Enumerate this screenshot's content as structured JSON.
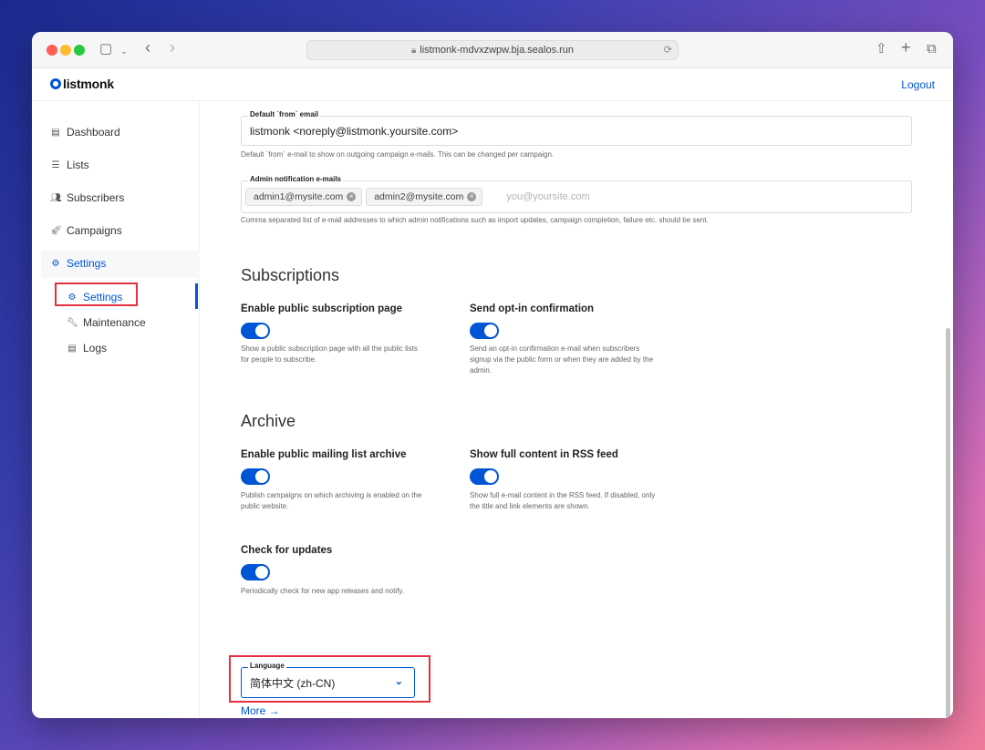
{
  "browser": {
    "url": "listmonk-mdvxzwpw.bja.sealos.run",
    "translate_icon": "translate-icon",
    "reload_icon": "reload-icon"
  },
  "app": {
    "logo": "listmonk",
    "logout": "Logout"
  },
  "sidebar": {
    "items": [
      {
        "label": "Dashboard",
        "icon": "dashboard-icon"
      },
      {
        "label": "Lists",
        "icon": "list-icon"
      },
      {
        "label": "Subscribers",
        "icon": "users-icon"
      },
      {
        "label": "Campaigns",
        "icon": "rocket-icon"
      },
      {
        "label": "Settings",
        "icon": "gear-icon"
      }
    ],
    "subitems": [
      {
        "label": "Settings",
        "icon": "gear-icon"
      },
      {
        "label": "Maintenance",
        "icon": "wrench-icon"
      },
      {
        "label": "Logs",
        "icon": "log-icon"
      }
    ]
  },
  "general": {
    "from_email": {
      "label": "Default `from` email",
      "value": "listmonk <noreply@listmonk.yoursite.com>",
      "help": "Default `from` e-mail to show on outgoing campaign e-mails. This can be changed per campaign."
    },
    "admin_emails": {
      "label": "Admin notification e-mails",
      "tags": [
        "admin1@mysite.com",
        "admin2@mysite.com"
      ],
      "placeholder": "you@yoursite.com",
      "help": "Comma separated list of e-mail addresses to which admin notifications such as import updates, campaign completion, failure etc. should be sent."
    }
  },
  "subscriptions": {
    "title": "Subscriptions",
    "public_page": {
      "title": "Enable public subscription page",
      "enabled": true,
      "help1": "Show a public subscription page with all the public lists",
      "help2": "for people to subscribe."
    },
    "optin": {
      "title": "Send opt-in confirmation",
      "enabled": true,
      "help1": "Send an opt-in confirmation e-mail when subscribers",
      "help2": "signup via the public form or when they are added by the",
      "help3": "admin."
    }
  },
  "archive": {
    "title": "Archive",
    "public_archive": {
      "title": "Enable public mailing list archive",
      "enabled": true,
      "help1": "Publish campaigns on which archiving is enabled on the",
      "help2": "public website."
    },
    "rss_full": {
      "title": "Show full content in RSS feed",
      "enabled": true,
      "help1": "Show full e-mail content in the RSS feed. If disabled, only",
      "help2": "the title and link elements are shown."
    }
  },
  "updates": {
    "title": "Check for updates",
    "enabled": true,
    "help": "Periodically check for new app releases and notify."
  },
  "language": {
    "label": "Language",
    "value": "简体中文 (zh-CN)",
    "more": "More →"
  },
  "colors": {
    "accent": "#0055d4",
    "highlight": "#e5303f"
  }
}
